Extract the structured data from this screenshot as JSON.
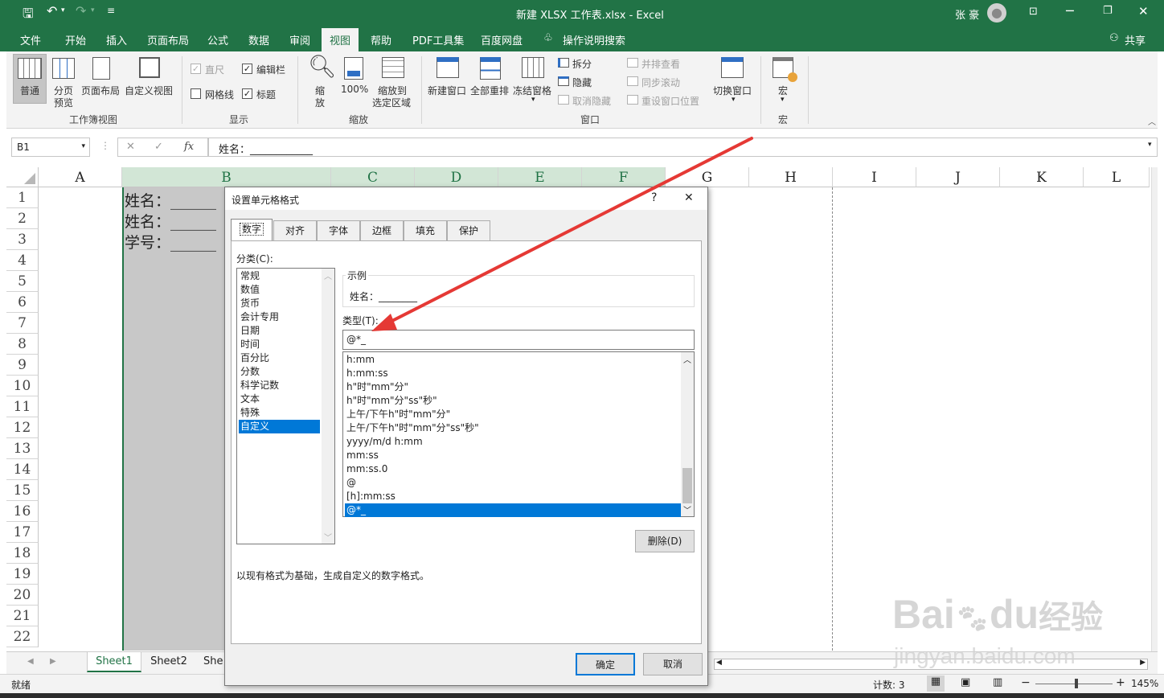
{
  "title_bar": {
    "doc_title": "新建 XLSX 工作表.xlsx  -  Excel",
    "user": "张 豪"
  },
  "tabs": [
    "文件",
    "开始",
    "插入",
    "页面布局",
    "公式",
    "数据",
    "审阅",
    "视图",
    "帮助",
    "PDF工具集",
    "百度网盘"
  ],
  "tell_me": "操作说明搜索",
  "share": "共享",
  "ribbon": {
    "workbook_views": {
      "group": "工作簿视图",
      "normal": "普通",
      "page_break_1": "分页",
      "page_break_2": "预览",
      "page_layout": "页面布局",
      "custom_views": "自定义视图"
    },
    "show": {
      "group": "显示",
      "ruler": "直尺",
      "formula_bar": "编辑栏",
      "gridlines": "网格线",
      "headings": "标题",
      "ruler_checked": true,
      "formula_bar_checked": true,
      "gridlines_checked": false,
      "headings_checked": true
    },
    "zoom": {
      "group": "缩放",
      "zoom_1": "缩",
      "zoom_2": "放",
      "hundred": "100%",
      "to_sel_1": "缩放到",
      "to_sel_2": "选定区域"
    },
    "window": {
      "group": "窗口",
      "new_window": "新建窗口",
      "arrange_all": "全部重排",
      "freeze": "冻结窗格",
      "split": "拆分",
      "hide": "隐藏",
      "unhide": "取消隐藏",
      "side_by_side": "并排查看",
      "sync_scroll": "同步滚动",
      "reset_pos": "重设窗口位置",
      "switch": "切换窗口"
    },
    "macros": {
      "group": "宏",
      "macros": "宏"
    }
  },
  "formula_bar": {
    "name_box": "B1",
    "fx": "fx",
    "content": "姓名：____________"
  },
  "columns": [
    "A",
    "B",
    "C",
    "D",
    "E",
    "F",
    "G",
    "H",
    "I",
    "J",
    "K",
    "L"
  ],
  "rows": [
    "1",
    "2",
    "3",
    "4",
    "5",
    "6",
    "7",
    "8",
    "9",
    "10",
    "11",
    "12",
    "13",
    "14",
    "15",
    "16",
    "17",
    "18",
    "19",
    "20",
    "21",
    "22"
  ],
  "cells": {
    "B1": "姓名：______",
    "B2": "姓名：______",
    "B3": "学号：______"
  },
  "sheets": [
    "Sheet1",
    "Sheet2",
    "She"
  ],
  "status": {
    "ready": "就绪",
    "count": "计数: 3",
    "zoom": "145%"
  },
  "dialog": {
    "title": "设置单元格格式",
    "help": "?",
    "close": "✕",
    "tabs": [
      "数字",
      "对齐",
      "字体",
      "边框",
      "填充",
      "保护"
    ],
    "category_label": "分类(C):",
    "categories": [
      "常规",
      "数值",
      "货币",
      "会计专用",
      "日期",
      "时间",
      "百分比",
      "分数",
      "科学记数",
      "文本",
      "特殊",
      "自定义"
    ],
    "selected_category": "自定义",
    "sample_label": "示例",
    "sample_value": "姓名：________",
    "type_label": "类型(T):",
    "type_value": "@*_",
    "formats": [
      "h:mm",
      "h:mm:ss",
      "h\"时\"mm\"分\"",
      "h\"时\"mm\"分\"ss\"秒\"",
      "上午/下午h\"时\"mm\"分\"",
      "上午/下午h\"时\"mm\"分\"ss\"秒\"",
      "yyyy/m/d h:mm",
      "mm:ss",
      "mm:ss.0",
      "@",
      "[h]:mm:ss",
      "@*_"
    ],
    "selected_format": "@*_",
    "delete": "删除(D)",
    "description": "以现有格式为基础，生成自定义的数字格式。",
    "ok": "确定",
    "cancel": "取消"
  },
  "watermark": {
    "text1": "Bai",
    "text2": "du",
    "text3": "经验",
    "url": "jingyan.baidu.com"
  },
  "colors": {
    "excel_green": "#217346",
    "selection": "#0078d7",
    "arrow": "#e53935"
  }
}
